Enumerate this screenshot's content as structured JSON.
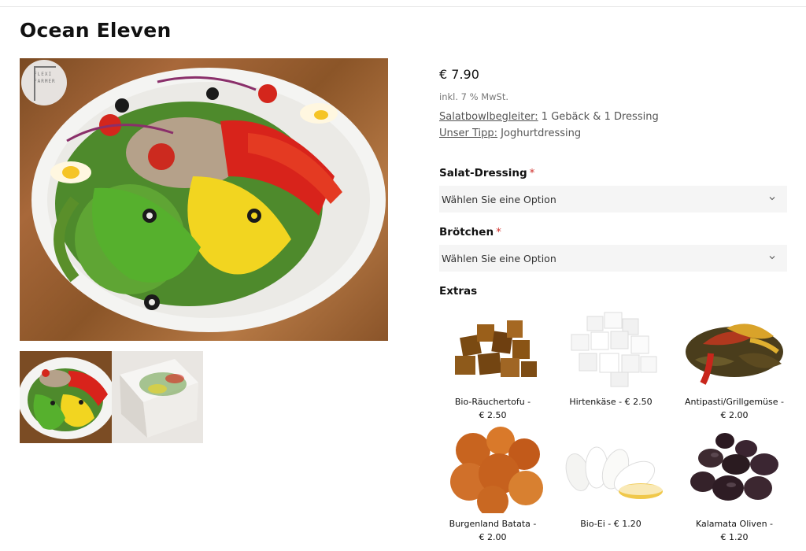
{
  "product": {
    "title": "Ocean Eleven",
    "price": "€ 7.90",
    "tax_note": "inkl. 7 % MwSt.",
    "companions_label": "Salatbowlbegleiter:",
    "companions_value": " 1 Gebäck & 1 Dressing",
    "tip_label": "Unser Tipp:",
    "tip_value": " Joghurtdressing",
    "logo_text": "FLEXI FARMER"
  },
  "options": {
    "dressing": {
      "label": "Salat-Dressing",
      "required_mark": "*",
      "selected": "Wählen Sie eine Option"
    },
    "broetchen": {
      "label": "Brötchen",
      "required_mark": "*",
      "selected": "Wählen Sie eine Option"
    }
  },
  "extras": {
    "label": "Extras",
    "items": [
      {
        "name": "Bio-Räuchertofu -",
        "price": "€ 2.50"
      },
      {
        "name": "Hirtenkäse - € 2.50",
        "price": ""
      },
      {
        "name": "Antipasti/Grillgemüse -",
        "price": "€ 2.00"
      },
      {
        "name": "Burgenland Batata -",
        "price": "€ 2.00"
      },
      {
        "name": "Bio-Ei - € 1.20",
        "price": ""
      },
      {
        "name": "Kalamata Oliven -",
        "price": "€ 1.20"
      }
    ]
  },
  "colors": {
    "required": "#d0312d",
    "select_bg": "#f5f5f5",
    "text": "#111111",
    "muted": "#777777"
  }
}
